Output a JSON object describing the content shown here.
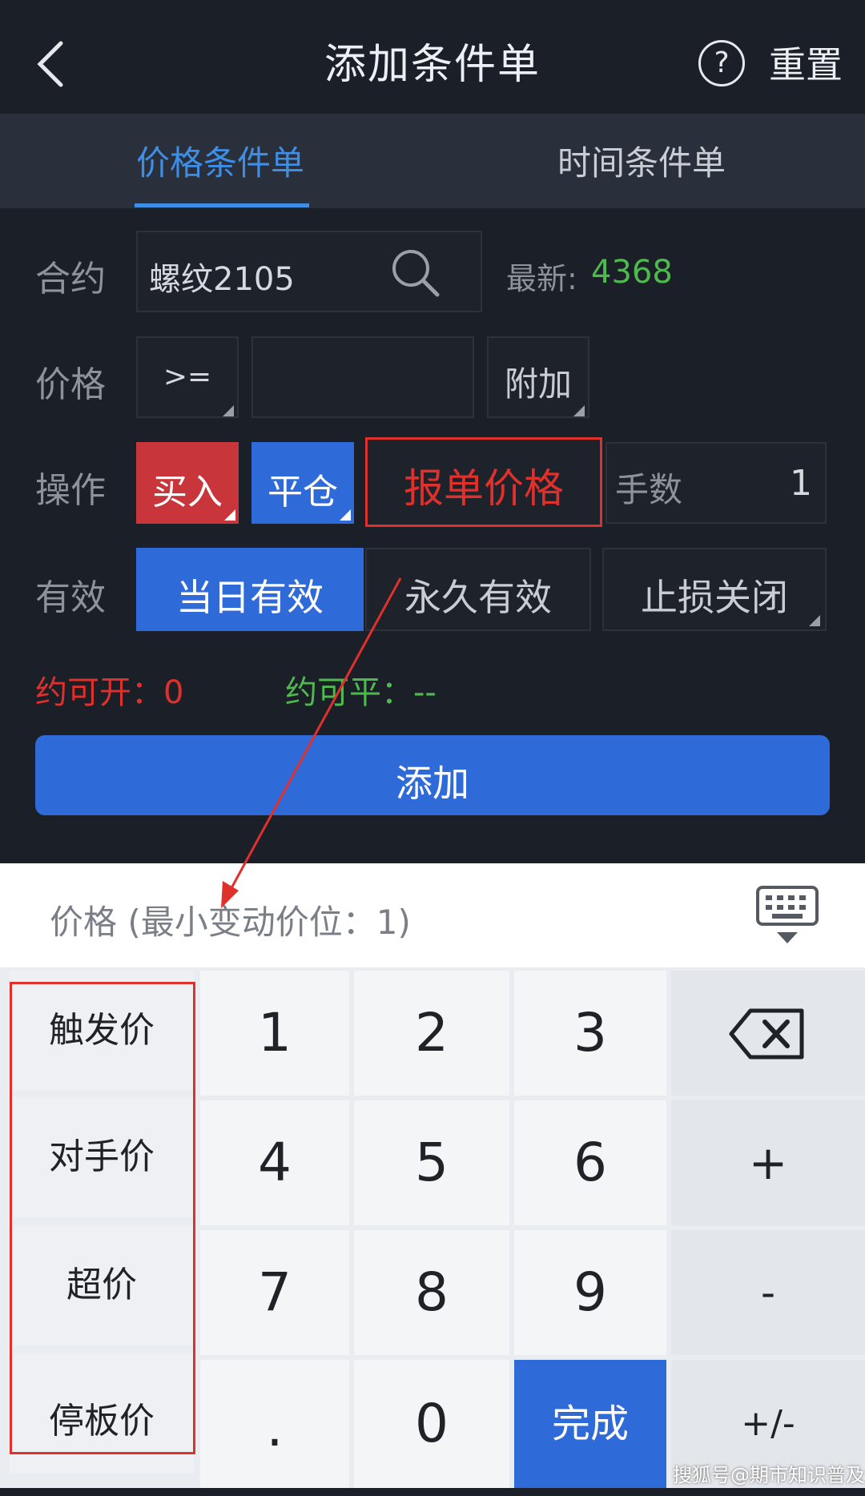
{
  "header": {
    "title": "添加条件单",
    "reset_label": "重置",
    "help_glyph": "?"
  },
  "tabs": [
    {
      "label": "价格条件单",
      "active": true
    },
    {
      "label": "时间条件单",
      "active": false
    }
  ],
  "form": {
    "contract": {
      "label": "合约",
      "value": "螺纹2105",
      "latest_label": "最新:",
      "latest_value": "4368"
    },
    "price": {
      "label": "价格",
      "operator": ">=",
      "value": "",
      "attach_label": "附加"
    },
    "operation": {
      "label": "操作",
      "buy_label": "买入",
      "close_label": "平仓",
      "order_price_label": "报单价格",
      "lots_label": "手数",
      "lots_value": "1"
    },
    "validity": {
      "label": "有效",
      "day_label": "当日有效",
      "permanent_label": "永久有效",
      "stoploss_label": "止损关闭"
    },
    "can_open": "约可开：0",
    "can_close": "约可平：--",
    "add_label": "添加"
  },
  "keyboard": {
    "hint": "价格 (最小变动价位：1)",
    "side_keys": [
      "触发价",
      "对手价",
      "超价",
      "停板价"
    ],
    "rows": [
      [
        "1",
        "2",
        "3"
      ],
      [
        "4",
        "5",
        "6"
      ],
      [
        "7",
        "8",
        "9"
      ],
      [
        ".",
        "0",
        "完成"
      ]
    ],
    "right_keys": [
      "backspace",
      "+",
      "-",
      "+/-"
    ]
  },
  "watermark": "搜狐号@期市知识普及",
  "colors": {
    "accent_blue": "#2f6bd8",
    "tab_blue": "#3f8ee6",
    "buy_red": "#c8363b",
    "highlight_red": "#e0302c",
    "price_green": "#4fb84f",
    "background": "#1b1f28"
  }
}
